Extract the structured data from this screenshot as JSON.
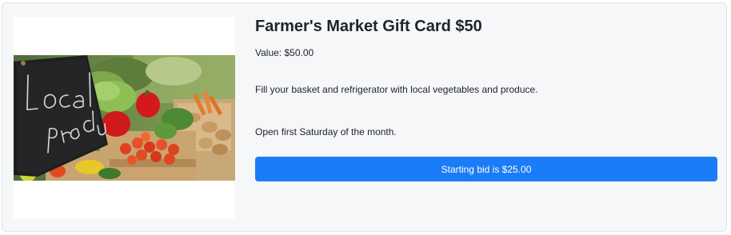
{
  "item": {
    "title": "Farmer's Market Gift Card $50",
    "value_line": "Value: $50.00",
    "description_1": "Fill your basket and refrigerator with local vegetables and produce.",
    "description_2": "Open first Saturday of the month.",
    "bid_button_label": "Starting bid is $25.00",
    "photo_chalkboard_text": "Local products"
  },
  "colors": {
    "card_background": "#f6f7f9",
    "button_blue": "#1a7cf6",
    "chalkboard": "#1d1f20"
  }
}
